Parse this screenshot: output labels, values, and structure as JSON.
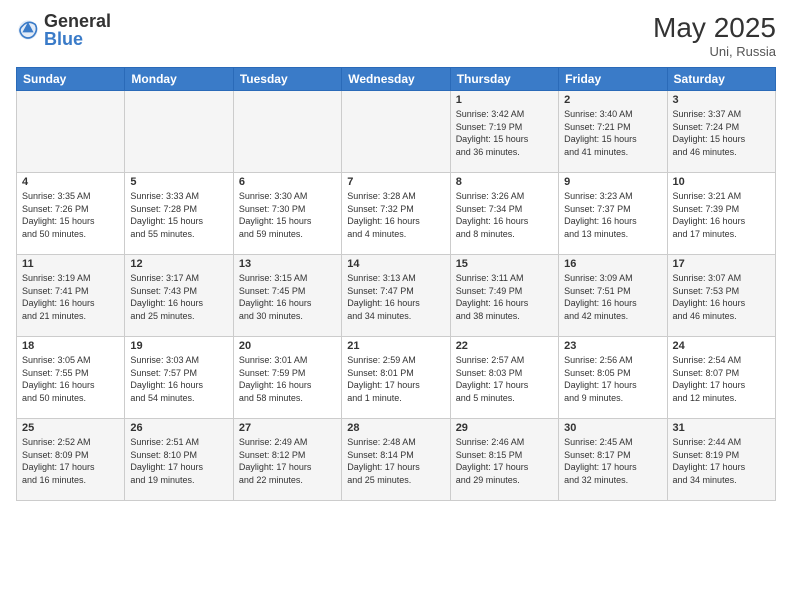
{
  "header": {
    "logo_general": "General",
    "logo_blue": "Blue",
    "month_year": "May 2025",
    "location": "Uni, Russia"
  },
  "weekdays": [
    "Sunday",
    "Monday",
    "Tuesday",
    "Wednesday",
    "Thursday",
    "Friday",
    "Saturday"
  ],
  "rows": [
    [
      {
        "day": "",
        "info": ""
      },
      {
        "day": "",
        "info": ""
      },
      {
        "day": "",
        "info": ""
      },
      {
        "day": "",
        "info": ""
      },
      {
        "day": "1",
        "info": "Sunrise: 3:42 AM\nSunset: 7:19 PM\nDaylight: 15 hours\nand 36 minutes."
      },
      {
        "day": "2",
        "info": "Sunrise: 3:40 AM\nSunset: 7:21 PM\nDaylight: 15 hours\nand 41 minutes."
      },
      {
        "day": "3",
        "info": "Sunrise: 3:37 AM\nSunset: 7:24 PM\nDaylight: 15 hours\nand 46 minutes."
      }
    ],
    [
      {
        "day": "4",
        "info": "Sunrise: 3:35 AM\nSunset: 7:26 PM\nDaylight: 15 hours\nand 50 minutes."
      },
      {
        "day": "5",
        "info": "Sunrise: 3:33 AM\nSunset: 7:28 PM\nDaylight: 15 hours\nand 55 minutes."
      },
      {
        "day": "6",
        "info": "Sunrise: 3:30 AM\nSunset: 7:30 PM\nDaylight: 15 hours\nand 59 minutes."
      },
      {
        "day": "7",
        "info": "Sunrise: 3:28 AM\nSunset: 7:32 PM\nDaylight: 16 hours\nand 4 minutes."
      },
      {
        "day": "8",
        "info": "Sunrise: 3:26 AM\nSunset: 7:34 PM\nDaylight: 16 hours\nand 8 minutes."
      },
      {
        "day": "9",
        "info": "Sunrise: 3:23 AM\nSunset: 7:37 PM\nDaylight: 16 hours\nand 13 minutes."
      },
      {
        "day": "10",
        "info": "Sunrise: 3:21 AM\nSunset: 7:39 PM\nDaylight: 16 hours\nand 17 minutes."
      }
    ],
    [
      {
        "day": "11",
        "info": "Sunrise: 3:19 AM\nSunset: 7:41 PM\nDaylight: 16 hours\nand 21 minutes."
      },
      {
        "day": "12",
        "info": "Sunrise: 3:17 AM\nSunset: 7:43 PM\nDaylight: 16 hours\nand 25 minutes."
      },
      {
        "day": "13",
        "info": "Sunrise: 3:15 AM\nSunset: 7:45 PM\nDaylight: 16 hours\nand 30 minutes."
      },
      {
        "day": "14",
        "info": "Sunrise: 3:13 AM\nSunset: 7:47 PM\nDaylight: 16 hours\nand 34 minutes."
      },
      {
        "day": "15",
        "info": "Sunrise: 3:11 AM\nSunset: 7:49 PM\nDaylight: 16 hours\nand 38 minutes."
      },
      {
        "day": "16",
        "info": "Sunrise: 3:09 AM\nSunset: 7:51 PM\nDaylight: 16 hours\nand 42 minutes."
      },
      {
        "day": "17",
        "info": "Sunrise: 3:07 AM\nSunset: 7:53 PM\nDaylight: 16 hours\nand 46 minutes."
      }
    ],
    [
      {
        "day": "18",
        "info": "Sunrise: 3:05 AM\nSunset: 7:55 PM\nDaylight: 16 hours\nand 50 minutes."
      },
      {
        "day": "19",
        "info": "Sunrise: 3:03 AM\nSunset: 7:57 PM\nDaylight: 16 hours\nand 54 minutes."
      },
      {
        "day": "20",
        "info": "Sunrise: 3:01 AM\nSunset: 7:59 PM\nDaylight: 16 hours\nand 58 minutes."
      },
      {
        "day": "21",
        "info": "Sunrise: 2:59 AM\nSunset: 8:01 PM\nDaylight: 17 hours\nand 1 minute."
      },
      {
        "day": "22",
        "info": "Sunrise: 2:57 AM\nSunset: 8:03 PM\nDaylight: 17 hours\nand 5 minutes."
      },
      {
        "day": "23",
        "info": "Sunrise: 2:56 AM\nSunset: 8:05 PM\nDaylight: 17 hours\nand 9 minutes."
      },
      {
        "day": "24",
        "info": "Sunrise: 2:54 AM\nSunset: 8:07 PM\nDaylight: 17 hours\nand 12 minutes."
      }
    ],
    [
      {
        "day": "25",
        "info": "Sunrise: 2:52 AM\nSunset: 8:09 PM\nDaylight: 17 hours\nand 16 minutes."
      },
      {
        "day": "26",
        "info": "Sunrise: 2:51 AM\nSunset: 8:10 PM\nDaylight: 17 hours\nand 19 minutes."
      },
      {
        "day": "27",
        "info": "Sunrise: 2:49 AM\nSunset: 8:12 PM\nDaylight: 17 hours\nand 22 minutes."
      },
      {
        "day": "28",
        "info": "Sunrise: 2:48 AM\nSunset: 8:14 PM\nDaylight: 17 hours\nand 25 minutes."
      },
      {
        "day": "29",
        "info": "Sunrise: 2:46 AM\nSunset: 8:15 PM\nDaylight: 17 hours\nand 29 minutes."
      },
      {
        "day": "30",
        "info": "Sunrise: 2:45 AM\nSunset: 8:17 PM\nDaylight: 17 hours\nand 32 minutes."
      },
      {
        "day": "31",
        "info": "Sunrise: 2:44 AM\nSunset: 8:19 PM\nDaylight: 17 hours\nand 34 minutes."
      }
    ]
  ]
}
